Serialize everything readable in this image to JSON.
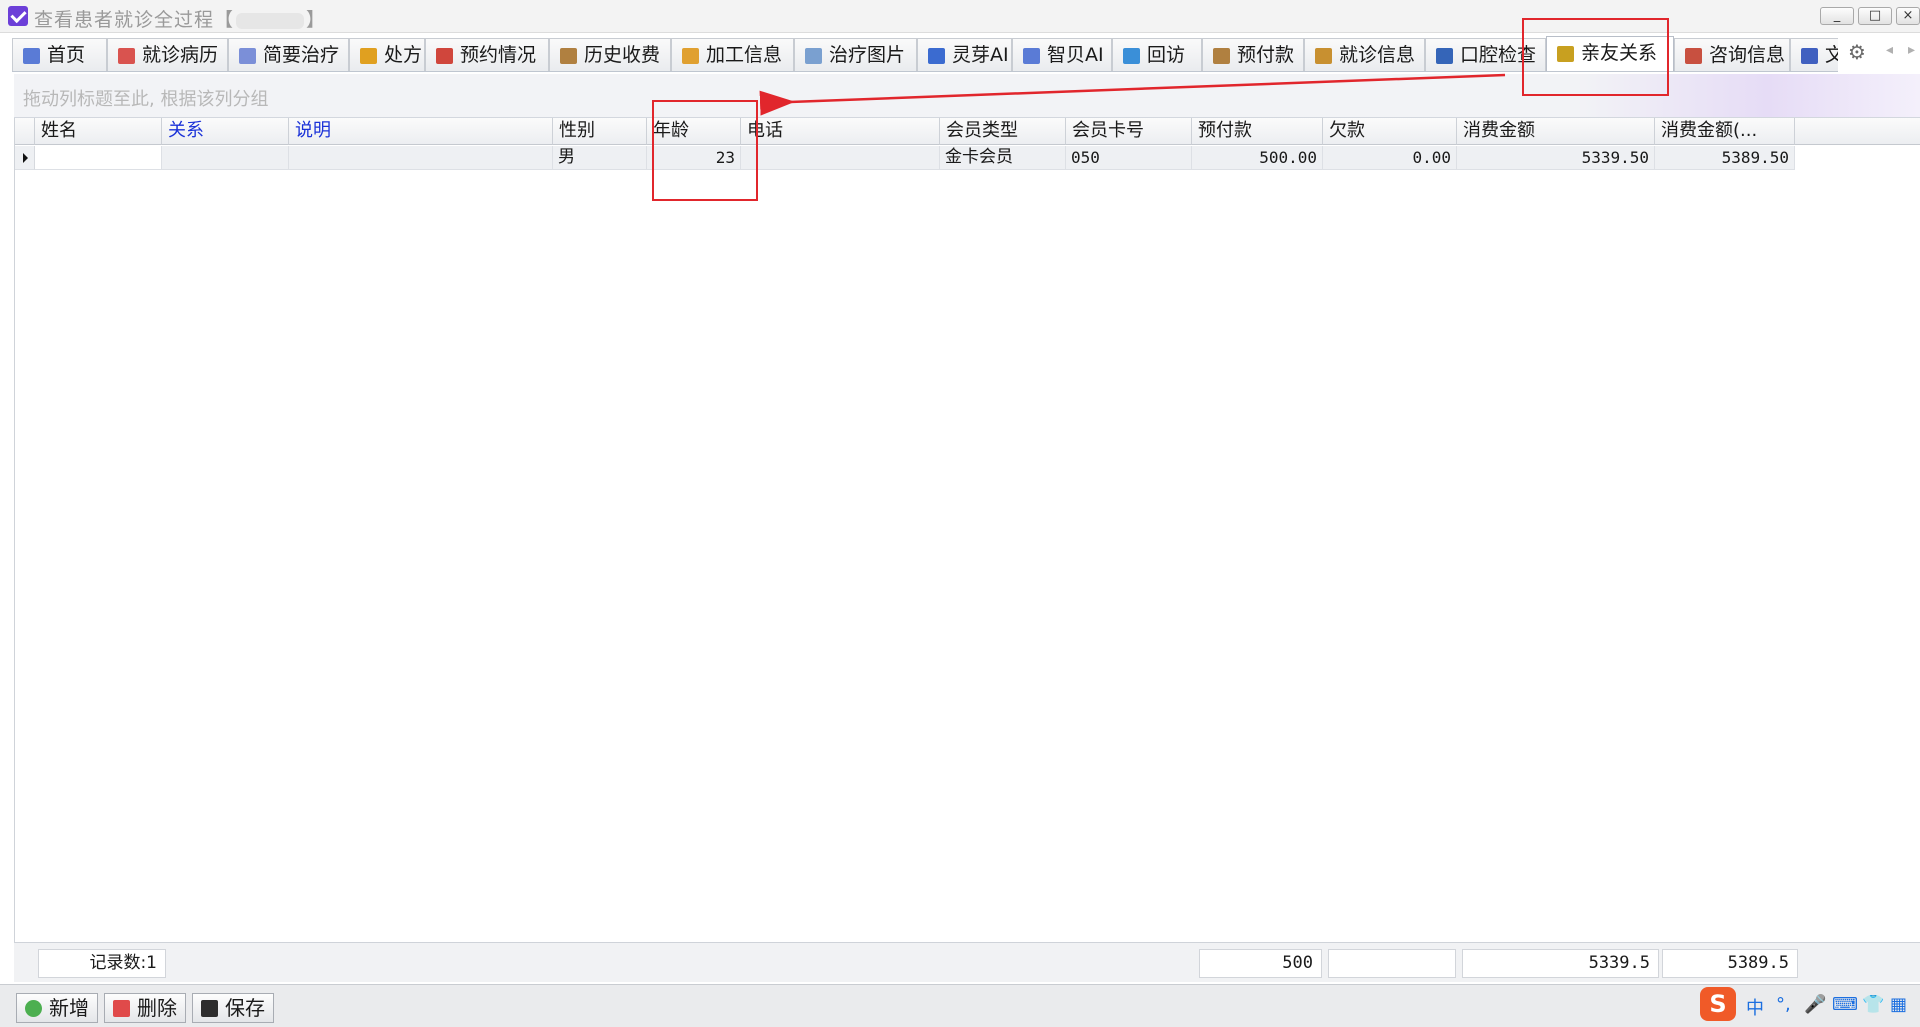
{
  "window": {
    "title_prefix": "查看患者就诊全过程【",
    "title_suffix": "】",
    "minimize_label": "_",
    "maximize_label": "□",
    "close_label": "×"
  },
  "tabs": [
    {
      "label": "首页",
      "icon": "home-icon",
      "color": "#5a7bd6"
    },
    {
      "label": "就诊病历",
      "icon": "medical-record-icon",
      "color": "#d9534f"
    },
    {
      "label": "简要治疗",
      "icon": "document-icon",
      "color": "#7b8fd8"
    },
    {
      "label": "处方",
      "icon": "pill-icon",
      "color": "#e0a020"
    },
    {
      "label": "预约情况",
      "icon": "calendar-icon",
      "color": "#d0463c"
    },
    {
      "label": "历史收费",
      "icon": "receipt-icon",
      "color": "#b08040"
    },
    {
      "label": "加工信息",
      "icon": "process-icon",
      "color": "#e0a030"
    },
    {
      "label": "治疗图片",
      "icon": "image-icon",
      "color": "#7aa0d0"
    },
    {
      "label": "灵芽AI",
      "icon": "eye-icon",
      "color": "#3b6bd0"
    },
    {
      "label": "智贝AI",
      "icon": "window-icon",
      "color": "#5a7bd6"
    },
    {
      "label": "回访",
      "icon": "refresh-icon",
      "color": "#3a8fd8"
    },
    {
      "label": "预付款",
      "icon": "prepay-icon",
      "color": "#b08040"
    },
    {
      "label": "就诊信息",
      "icon": "clipboard-icon",
      "color": "#c89030"
    },
    {
      "label": "口腔检查",
      "icon": "briefcase-icon",
      "color": "#3565b8"
    },
    {
      "label": "亲友关系",
      "icon": "people-icon",
      "color": "#c8a020"
    },
    {
      "label": "咨询信息",
      "icon": "consult-icon",
      "color": "#c85040"
    },
    {
      "label": "文档",
      "icon": "spellcheck-icon",
      "color": "#4060c0"
    }
  ],
  "active_tab": "亲友关系",
  "group_panel": {
    "hint": "拖动列标题至此, 根据该列分组"
  },
  "grid": {
    "columns": [
      "姓名",
      "关系",
      "说明",
      "性别",
      "年龄",
      "电话",
      "会员类型",
      "会员卡号",
      "预付款",
      "欠款",
      "消费金额",
      "消费金额(..."
    ],
    "rows": [
      {
        "name": "",
        "relation": "",
        "note": "",
        "gender": "男",
        "age": "23",
        "phone": "",
        "member_type": "金卡会员",
        "card_no": "050",
        "prepay": "500.00",
        "debt": "0.00",
        "spent": "5339.50",
        "spent2": "5389.50"
      }
    ]
  },
  "footer": {
    "record_count": "记录数:1",
    "prepay_total": "500",
    "debt_total": "",
    "spent_total": "5339.5",
    "spent2_total": "5389.5"
  },
  "toolbar": {
    "add_label": "新增",
    "delete_label": "删除",
    "save_label": "保存"
  },
  "ime": {
    "logo": "S",
    "mode": "中",
    "punct": "°,",
    "mic": "🎤",
    "keyboard": "⌨"
  },
  "colors": {
    "annotation_red": "#e1262c",
    "header_blue": "#1b32d8"
  }
}
